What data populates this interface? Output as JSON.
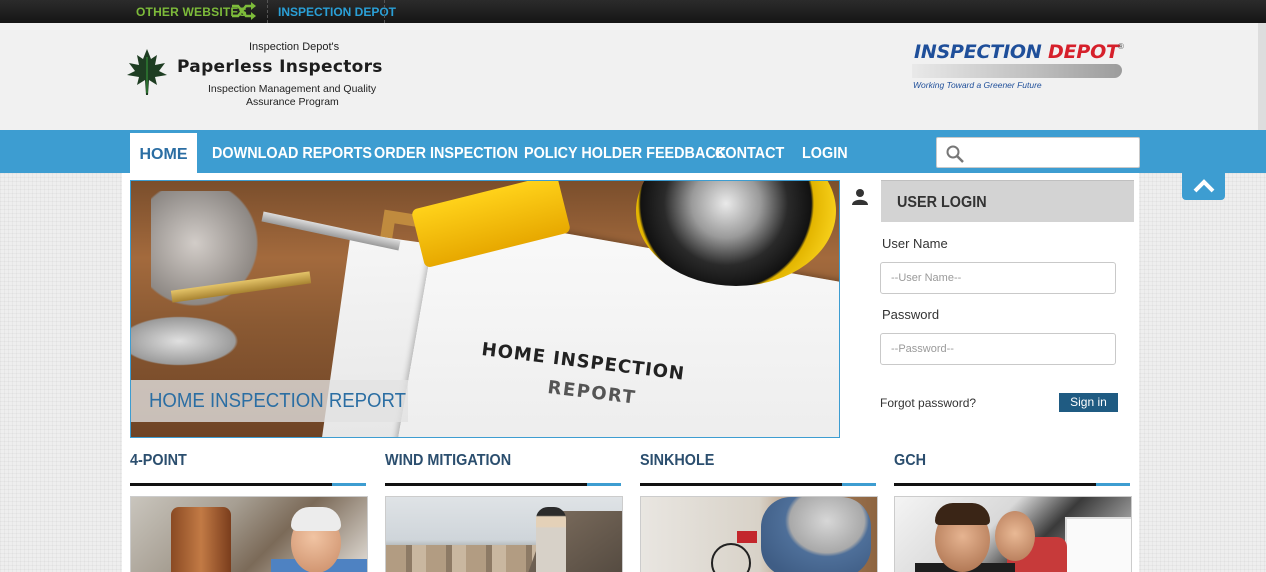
{
  "topbar": {
    "other_websites": "OTHER WEBSITES",
    "inspection_depot": "INSPECTION DEPOT"
  },
  "header": {
    "logo_small": "Inspection Depot's",
    "logo_title": "Paperless Inspectors",
    "logo_sub1": "Inspection Management and Quality",
    "logo_sub2": "Assurance Program",
    "partner_name_a": "Inspection ",
    "partner_name_b": "Depot",
    "partner_reg": "®",
    "partner_tagline": "Working Toward a Greener Future"
  },
  "nav": {
    "items": [
      {
        "label": "HOME"
      },
      {
        "label": "DOWNLOAD REPORTS"
      },
      {
        "label": "ORDER INSPECTION"
      },
      {
        "label": "POLICY HOLDER FEEDBACK"
      },
      {
        "label": "CONTACT"
      },
      {
        "label": "LOGIN"
      }
    ],
    "search_placeholder": ""
  },
  "hero": {
    "caption": "HOME INSPECTION REPORT",
    "paper_title1": "HOME INSPECTION",
    "paper_title2": "REPORT"
  },
  "login": {
    "heading": "USER LOGIN",
    "username_label": "User Name",
    "username_placeholder": "--User Name--",
    "password_label": "Password",
    "password_placeholder": "--Password--",
    "forgot": "Forgot password?",
    "signin": "Sign in"
  },
  "services": [
    {
      "title": "4-POINT"
    },
    {
      "title": "WIND MITIGATION"
    },
    {
      "title": "SINKHOLE"
    },
    {
      "title": "GCH"
    }
  ],
  "colors": {
    "nav_blue": "#3d9dd1",
    "green_accent": "#7dbb3a",
    "signin_blue": "#1f5b82"
  }
}
